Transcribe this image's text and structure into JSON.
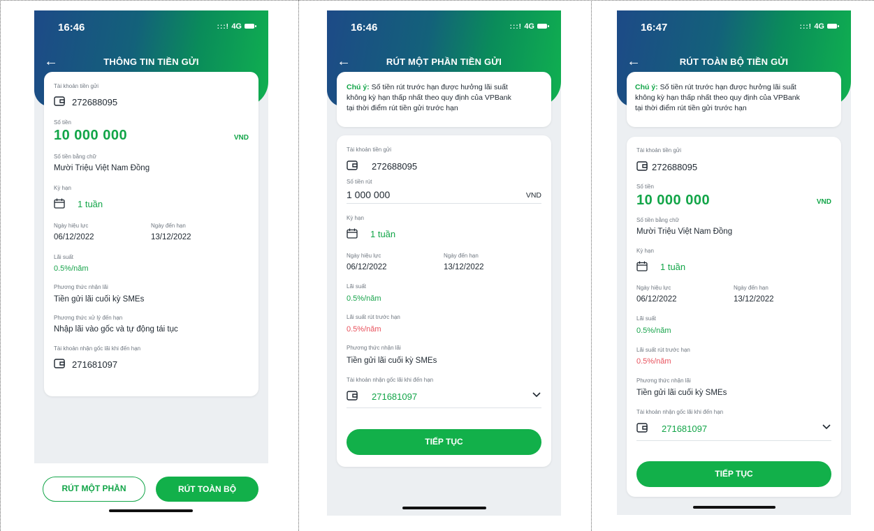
{
  "status": {
    "screen1_time": "16:46",
    "screen2_time": "16:46",
    "screen3_time": "16:47",
    "signal": ":::!",
    "network": "4G"
  },
  "screen1": {
    "title": "THÔNG TIN TIỀN GỬI",
    "account_label": "Tài khoản tiền gửi",
    "account_number": "272688095",
    "amount_label": "Số tiền",
    "amount_value": "10 000 000",
    "currency": "VND",
    "amount_words_label": "Số tiền bằng chữ",
    "amount_words": "Mười Triệu Việt Nam Đồng",
    "term_label": "Kỳ hạn",
    "term_value": "1 tuần",
    "effective_label": "Ngày hiệu lực",
    "effective_date": "06/12/2022",
    "maturity_label": "Ngày đến hạn",
    "maturity_date": "13/12/2022",
    "rate_label": "Lãi suất",
    "rate_value": "0.5%/năm",
    "interest_method_label": "Phương thức nhận lãi",
    "interest_method": "Tiền gửi lãi cuối kỳ SMEs",
    "maturity_method_label": "Phương thức xử lý đến hạn",
    "maturity_method": "Nhập lãi vào gốc và tự động tái tục",
    "receive_account_label": "Tài khoản nhận gốc lãi khi đến hạn",
    "receive_account": "271681097",
    "btn_partial": "RÚT MỘT PHẦN",
    "btn_full": "RÚT TOÀN BỘ"
  },
  "screen2": {
    "title": "RÚT MỘT PHẦN TIỀN GỬI",
    "note_prefix": "Chú ý:",
    "note_line1": " Số tiền rút trước hạn được hưởng lãi suất",
    "note_line2": "không kỳ hạn thấp nhất theo quy định của VPBank",
    "note_line3": "tại thời điểm rút tiền gửi trước hạn",
    "account_label": "Tài khoản tiền gửi",
    "account_number": "272688095",
    "withdraw_label": "Số tiền rút",
    "withdraw_value": "1 000 000",
    "currency": "VND",
    "term_label": "Kỳ hạn",
    "term_value": "1 tuần",
    "effective_label": "Ngày hiệu lực",
    "effective_date": "06/12/2022",
    "maturity_label": "Ngày đến hạn",
    "maturity_date": "13/12/2022",
    "rate_label": "Lãi suất",
    "rate_value": "0.5%/năm",
    "early_rate_label": "Lãi suất rút trước hạn",
    "early_rate_value": "0.5%/năm",
    "interest_method_label": "Phương thức nhận lãi",
    "interest_method": "Tiền gửi lãi cuối kỳ SMEs",
    "receive_account_label": "Tài khoản nhận gốc lãi khi đến hạn",
    "receive_account": "271681097",
    "btn_continue": "TIẾP TỤC"
  },
  "screen3": {
    "title": "RÚT TOÀN BỘ TIỀN GỬI",
    "note_prefix": "Chú ý:",
    "note_line1": " Số tiền rút trước hạn được hưởng lãi suất",
    "note_line2": "không kỳ hạn thấp nhất theo quy định của VPBank",
    "note_line3": "tại thời điểm rút tiền gửi trước hạn",
    "account_label": "Tài khoản tiền gửi",
    "account_number": "272688095",
    "amount_label": "Số tiền",
    "amount_value": "10 000 000",
    "currency": "VND",
    "amount_words_label": "Số tiền bằng chữ",
    "amount_words": "Mười Triệu Việt Nam Đồng",
    "term_label": "Kỳ hạn",
    "term_value": "1 tuần",
    "effective_label": "Ngày hiệu lực",
    "effective_date": "06/12/2022",
    "maturity_label": "Ngày đến hạn",
    "maturity_date": "13/12/2022",
    "rate_label": "Lãi suất",
    "rate_value": "0.5%/năm",
    "early_rate_label": "Lãi suất rút trước hạn",
    "early_rate_value": "0.5%/năm",
    "interest_method_label": "Phương thức nhận lãi",
    "interest_method": "Tiền gửi lãi cuối kỳ SMEs",
    "receive_account_label": "Tài khoản nhận gốc lãi khi đến hạn",
    "receive_account": "271681097",
    "btn_continue": "TIẾP TỤC"
  },
  "icons": {
    "wallet": "wallet-icon",
    "calendar": "calendar-icon",
    "back": "back-arrow-icon",
    "chevron": "chevron-down-icon"
  },
  "colors": {
    "green": "#12a548",
    "button_green": "#12b04a",
    "header_blue": "#1d4a87",
    "red": "#e8505b"
  }
}
